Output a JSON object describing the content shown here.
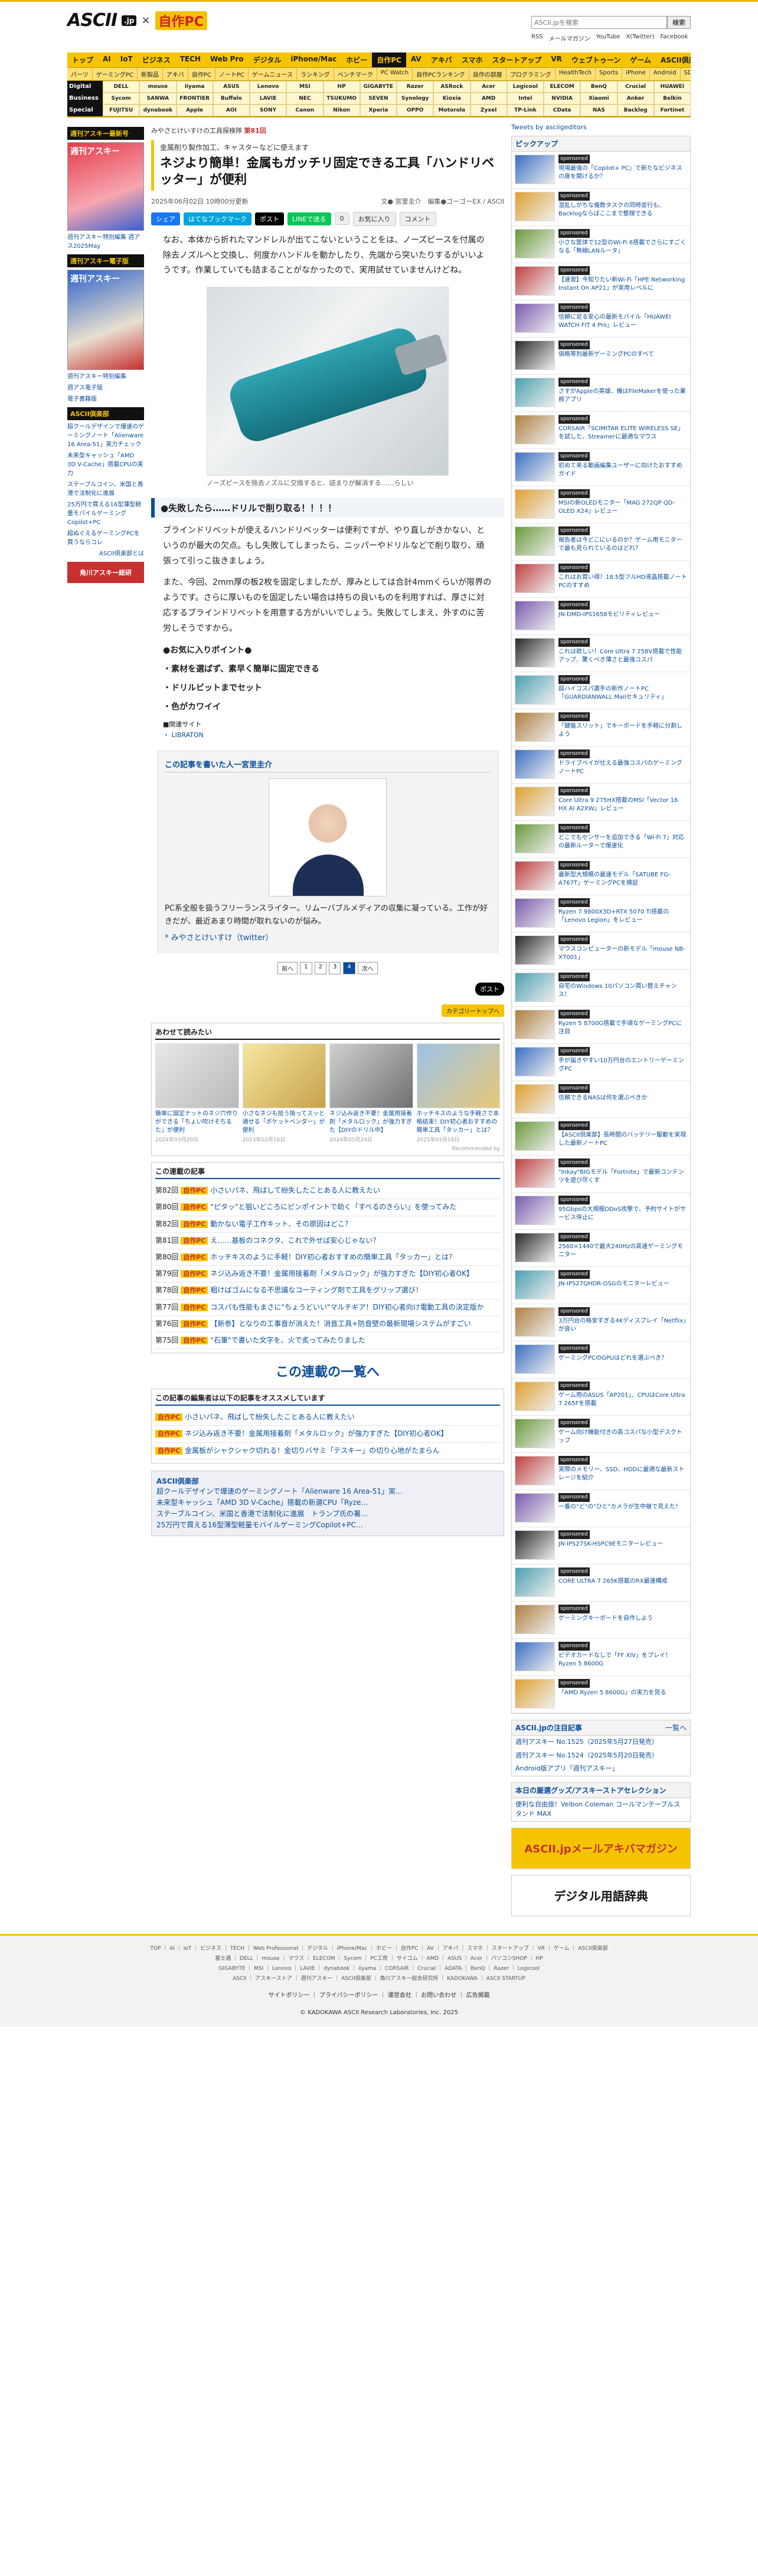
{
  "header": {
    "logo_ascii": "ASCII",
    "logo_jp": ".jp",
    "logo_x": "×",
    "logo_pc": "自作PC",
    "search_placeholder": "ASCII.jpを検索",
    "search_button": "検索",
    "links": [
      "RSS",
      "メールマガジン",
      "YouTube",
      "X(Twitter)",
      "Facebook"
    ]
  },
  "nav": {
    "main": [
      "トップ",
      "AI",
      "IoT",
      "ビジネス",
      "TECH",
      "Web Pro",
      "デジタル",
      "iPhone/Mac",
      "ホビー",
      "自作PC",
      "AV",
      "アキバ",
      "スマホ",
      "スタートアップ",
      "VR",
      "ウェブトゥーン",
      "ゲーム",
      "ASCII倶楽部"
    ],
    "active_index": 9,
    "sub": [
      "パーツ",
      "ゲーミングPC",
      "新製品",
      "アキバ",
      "自作PC",
      "ノートPC",
      "ゲームニュース",
      "ランキング",
      "ベンチマーク",
      "PC Watch",
      "自作PCランキング",
      "自作の部屋",
      "プログラミング",
      "HealthTech",
      "Sports",
      "iPhone",
      "Android",
      "SDGs",
      "特集"
    ],
    "brand_rows": [
      {
        "label": "Digital",
        "items": [
          "DELL",
          "mouse",
          "iiyama",
          "ASUS",
          "Lenovo",
          "MSI",
          "HP",
          "GIGABYTE",
          "Razer",
          "ASRock",
          "Acer",
          "Logicool",
          "ELECOM",
          "BenQ",
          "Crucial",
          "HUAWEI"
        ]
      },
      {
        "label": "Business",
        "items": [
          "Sycom",
          "SANWA",
          "FRONTIER",
          "Buffalo",
          "LAVIE",
          "NEC",
          "TSUKUMO",
          "SEVEN",
          "Synology",
          "Kioxia",
          "AMD",
          "Intel",
          "NVIDIA",
          "Xiaomi",
          "Anker",
          "Belkin"
        ]
      },
      {
        "label": "Special",
        "items": [
          "FUJITSU",
          "dynabook",
          "Apple",
          "AOI",
          "SONY",
          "Canon",
          "Nikon",
          "Xperia",
          "OPPO",
          "Motorola",
          "Zyxel",
          "TP-Link",
          "CData",
          "NAS",
          "Backlog",
          "Fortinet"
        ]
      }
    ]
  },
  "left": {
    "head1": "週刊アスキー最新号",
    "cover1_title": "週刊アスキー",
    "cover1_lines": [
      "AIスマホ",
      "新色レビュー"
    ],
    "text1": "週刊アスキー特別編集 週アス2025May",
    "head2": "週刊アスキー電子版",
    "cover2_title": "週刊アスキー",
    "cover2_lines": [
      "夏の自作PC",
      "特集"
    ],
    "text2": [
      "週刊アスキー特別編集",
      "週アス電子版",
      "電子書籍版"
    ],
    "head3": "ASCII倶楽部",
    "items3": [
      "超クールデザインで爆速のゲーミングノート「Alienware 16 Area-51」実力チェック",
      "未来型キャッシュ「AMD 3D V-Cache」搭載CPUの実力",
      "ステープルコイン、米国と香港で法制化に進展",
      "25万円で買える16型薄型軽量モバイルゲーミングCopilot+PC",
      "超ぬぐえるゲーミングPCを買うならコレ"
    ],
    "more3": "ASCII倶楽部とは",
    "banner": "角川アスキー総研"
  },
  "article": {
    "breadcrumb": [
      "みやさとけいすけの工具探検隊",
      "第81回"
    ],
    "kicker": "金属削り製作加工、キャスターなどに使えます",
    "title": "ネジより簡単！金属もガッチリ固定できる工具「ハンドリベッター」が便利",
    "date": "2025年06月02日 10時00分更新",
    "author": "文● 宮里圭介",
    "editor": "編集●ゴーゴーEX / ASCII",
    "social": {
      "share": "シェア",
      "hatena": "はてなブックマーク",
      "post": "ポスト",
      "line": "LINEで送る",
      "count": "0",
      "bookmark": "お気に入り",
      "comment": "コメント"
    },
    "p1": "なお、本体から折れたマンドレルが出てこないということをは、ノーズピースを付属の除去ノズルへと交換し、何度かハンドルを動かしたり、先端から突いたりするがいいようです。作業していても詰まることがなかったので、実用試せていませんけどね。",
    "caption": "ノーズピースを除去ノズルに交換すると、詰まりが解消する……らしい",
    "h2": "●失敗したら……ドリルで削り取る！！！！",
    "p2": "ブラインドリベットが使えるハンドリベッターは便利ですが、やり直しがきかない、というのが最大の欠点。もし失敗してしまったら、ニッパーやドリルなどで削り取り、頑張って引っこ抜きましょう。",
    "p3": "また、今回、2mm厚の板2枚を固定しましたが、厚みとしては合計4mmくらいが限界のようです。さらに厚いものを固定したい場合は持ちの良いものを利用すれば、厚さに対応するブラインドリベットを用意する方がいいでしょう。失敗してしまえ、外すのに苦労しそうですから。",
    "fav_head": "●お気に入りポイント●",
    "fav_items": [
      "・素材を選ばず、素早く簡単に固定できる",
      "・ドリルビットまでセット",
      "・色がカワイイ"
    ],
    "related_head": "■関連サイト",
    "related_item": "・ LIBRATON",
    "authbox_head": "この記事を書いた人一宮里圭介",
    "auth_text": "PC系全般を扱うフリーランスライター。リムーバブルメディアの収集に凝っている。工作が好きだが、最近あまり時間が取れないのが悩み。",
    "auth_link": "* みやさとけいすけ（twitter）",
    "pager": [
      "前へ",
      "1",
      "2",
      "3",
      "4",
      "次へ"
    ],
    "pager_cur": 4,
    "x_post": "ポスト",
    "cat_button": "カテゴリートップへ",
    "recommend_head": "あわせて読みたい",
    "recommend": [
      {
        "title": "簡単に固定ナットのネジ穴作りができる「ちょい吹けそちるた」が便利",
        "date": "2024年03月20日"
      },
      {
        "title": "小さなネジも拾う換ってスッと通せる「ポケットベンダー」が便利",
        "date": "2023年02月16日"
      },
      {
        "title": "ネジ込み返き不要！金属用接着剤「メタルロック」が強力すぎた【DIYのドリル中】",
        "date": "2024年05月24日"
      },
      {
        "title": "ホッチキスのような手軽さで本格結束！DIY初心者おすすめの簡単工具「タッカー」とは？",
        "date": "2025年03月18日"
      }
    ],
    "recommend_footer": "Recommended by",
    "series_head": "この連載の記事",
    "series": [
      {
        "no": "第82回",
        "title": "小さいパネ、飛ばして紛失したことある人に教えたい"
      },
      {
        "no": "第80回",
        "title": "\"ピタッ\"と狙いどころにピンポイントで助く「すべるのきらい」を使ってみた"
      },
      {
        "no": "第82回",
        "title": "動かない電子工作キット、その原因はどこ？"
      },
      {
        "no": "第81回",
        "title": "え……基板のコネクタ、これで外せば安心じゃない？"
      },
      {
        "no": "第80回",
        "title": "ホッチキスのように手軽！DIY初心者おすすめの簡単工具「タッカー」とは？"
      },
      {
        "no": "第79回",
        "title": "ネジ込み返き不要！金属用接着剤「メタルロック」が強力すぎた【DIY初心者OK】"
      },
      {
        "no": "第78回",
        "title": "粗けばゴムになる不思議なコーティング剤で工具をグリップ選び！"
      },
      {
        "no": "第77回",
        "title": "コスパも性能もまさに\"ちょうどいい\"マルチギア！DIY初心者向け電動工具の決定版か"
      },
      {
        "no": "第76回",
        "title": "【新参】となりの工事音が消えた！消音工具+防音壁の最新現場システムがすごい"
      },
      {
        "no": "第75回",
        "title": "\"石筆\"で書いた文字を、火で炙ってみたりました"
      }
    ],
    "series_all": "この連載の一覧へ",
    "editor_head": "この記事の編集者は以下の記事をオススメしています",
    "editor_recs": [
      "小さいパネ、飛ばして紛失したことある人に教えたい",
      "ネジ込み返き不要！金属用接着剤「メタルロック」が強力すぎた【DIY初心者OK】",
      "金属板がシャクシャク切れる！金切りバサミ「テスキー」の切り心地がたまらん"
    ],
    "ascii_head": "ASCII倶楽部",
    "ascii_items": [
      "超クールデザインで爆速のゲーミングノート「Alienware 16 Area-51」実…",
      "未来型キャッシュ「AMD 3D V-Cache」搭載の新選CPU「Ryze…",
      "ステーブルコイン、米国と香港で法制化に進展　トランプ氏の署…",
      "25万円で買える16型薄型軽量モバイルゲーミングCopilot+PC…"
    ]
  },
  "right": {
    "tweets": "Tweets by asciigeditors",
    "pickup_head": "ピックアップ",
    "sponsored_label": "sponsored",
    "pickups": [
      "現場最強の「Copilot+ PC」で新たなビジネスの扉を開けるか？",
      "混乱しがちな複数タスクの同時並行も、Backlogならばここまで整理できる",
      "小さな筐体で12型のWi-Fi 6搭載でさらにすごくなる「無線LANルータ」",
      "【速習】今知りたい新Wi-Fi「HPE Networking Instant On AP21」が実用レベルに",
      "信頼に足る安心の最新モバイル「HUAWEI WATCH FIT 4 Pro」レビュー",
      "価格帯別最新ゲーミングPCのすべて",
      "さすがAppleの英雄、機はFileMakerを使った業務アプリ",
      "CORSAIR「SCIMITAR ELITE WIRELESS SE」を試した、Streamerに最適なマウス",
      "初めて来る動画編集ユーザーに向けたおすすめガイド",
      "MSIの新OLEDモニター「MAG 272QP QD-OLED X24」レビュー",
      "報告者は今どこにいるのか？ゲーム用モニターで最も見られているのはどれ？",
      "これはお買い得！18.5型フルHD液晶搭載ノートPCのすすめ",
      "JN-DMD-IPS1658モビリティレビュー",
      "これは欲しい！Core Ultra 7 258V搭載で性能アップ、驚くべき薄さと最強コスパ",
      "超ハイコスパ選手の新作ノートPC「GUARDIANWALL Mailセキュリティ」",
      "「鍵盤スリット」でキーボードを手軽に分割しよう",
      "ドライブベイが仕える最強コスパのゲーミングノートPC",
      "Core Ultra 9 275HX搭載のMSI「Vector 16 HX AI A2XW」レビュー",
      "どこでもセンサーを追加できる「Wi-Fi 7」対応の最新ルーターで爆速化",
      "最新型大規模の最速モデル「SATUBE FG-A767T」ゲーミングPCを検証",
      "Ryzen 7 9800X3D+RTX 5070 Ti搭載の「Lenovo Legion」をレビュー",
      "マウスコンピューターの新モデル「mouse NB-X7001」",
      "自宅のWindows 10パソコン買い替えチャンス！",
      "Ryzen 5 8700G搭載で手頃なゲーミングPCに注目",
      "手が届きやすい10万円台のエントリーゲーミングPC",
      "信頼できるNASは何を選ぶべきか",
      "【ASCII倶楽部】長時間のバッテリー駆動を実現した最新ノートPC",
      "\"Inkay\"BIGモデル「Fortnite」で最新コンテンツを遊び尽くす",
      "95Gbpsの大規模DDoS攻撃で、予約サイトがサービス停止に",
      "2560×1440で最大240Hzの高速ゲーミングモニター",
      "JN-IPS27QHDR-OSGのモニターレビュー",
      "3万円台の格安すぎる4Kディスプレイ「Netflix」が良い",
      "ゲーミングPCのGPUはどれを選ぶべき？",
      "ゲーム用のASUS「AP201」、CPUはCore Ultra 7 265Fを搭載",
      "ゲーム向け機能付きの高コスパな小型デスクトップ",
      "実際のメモリー、SSD、HDDに最適な最新ストレージを紹介",
      "一番の\"ど\"の\"ひと\"カメラが生中継で見えた！",
      "JN-IPS27SK-HSPC9Eモニターレビュー",
      "CORE ULTRA 7 265K搭載のRX最速構成",
      "ゲーミングキーボードを自作しよう",
      "ビデオカードなしで「FF XIV」をプレイ！Ryzen 5 8600G",
      "「AMD Ryzen 5 8600G」の実力を見る"
    ],
    "ascii_news_head": "ASCII.jpの注目記事",
    "ascii_news_more": "一覧へ",
    "ascii_news": [
      "週刊アスキー No.1525（2025年5月27日発売）",
      "週刊アスキー No.1524（2025年5月20日発売）",
      "Android版アプリ「週刊アスキー」"
    ],
    "bags_head": "本日の厳選グッズ/アスキーストアセレクション",
    "bags_text": "便利な自由旅！Velbon Coleman コールマンテーブルスタンド MAX",
    "banner1": "ASCII.jpメールアキバマガジン",
    "banner2": "デジタル用語辞典"
  },
  "footer": {
    "links1": "TOP ｜ AI ｜ IoT ｜ ビジネス ｜ TECH ｜ Web Professional ｜ デジタル ｜ iPhone/Mac ｜ ホビー ｜ 自作PC ｜ AV ｜ アキバ ｜ スマホ ｜ スタートアップ ｜ VR ｜ ゲーム ｜ ASCII倶楽部",
    "links2": "富士通 ｜ DELL ｜ mouse ｜ マウス ｜ ELECOM ｜ Sycom ｜ PC工房 ｜ サイコム ｜ AMD ｜ ASUS ｜ Acer ｜ パソコンSHOP ｜ HP",
    "links3": "GIGABYTE ｜ MSI ｜ Lenovo ｜ LAVIE ｜ dynabook ｜ iiyama ｜ CORSAIR ｜ Crucial ｜ ADATA ｜ BenQ ｜ Razer ｜ Logicool",
    "links4": "ASCII ｜ アスキーストア ｜ 週刊アスキー ｜ ASCII倶楽部 ｜ 角川アスキー総合研究所 ｜ KADOKAWA ｜ ASCII STARTUP",
    "bottom_links": [
      "サイトポリシー",
      "プライバシーポリシー",
      "運営会社",
      "お問い合わせ",
      "広告掲載"
    ],
    "copyright": "© KADOKAWA ASCII Research Laboratories, Inc. 2025"
  }
}
